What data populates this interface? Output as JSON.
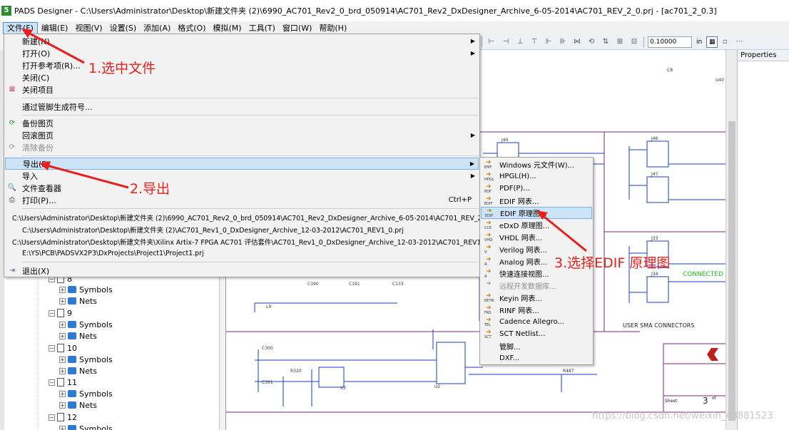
{
  "window": {
    "app_icon": "pads-app-icon",
    "title": "PADS Designer - C:\\Users\\Administrator\\Desktop\\新建文件夹 (2)\\6990_AC701_Rev2_0_brd_050914\\AC701_Rev2_DxDesigner_Archive_6-05-2014\\AC701_REV_2_0.prj - [ac701_2_0.3]"
  },
  "menubar": [
    "文件(F)",
    "编辑(E)",
    "视图(V)",
    "设置(S)",
    "添加(A)",
    "格式(O)",
    "模拟(M)",
    "工具(T)",
    "窗口(W)",
    "帮助(H)"
  ],
  "toolbar": {
    "zoom_value": "0.10000",
    "unit": "in"
  },
  "properties_title": "Properties",
  "tree": [
    {
      "type": "sheet",
      "label": "8"
    },
    {
      "type": "folder",
      "label": "Symbols"
    },
    {
      "type": "folder",
      "label": "Nets"
    },
    {
      "type": "sheet",
      "label": "9"
    },
    {
      "type": "folder",
      "label": "Symbols"
    },
    {
      "type": "folder",
      "label": "Nets"
    },
    {
      "type": "sheet",
      "label": "10"
    },
    {
      "type": "folder",
      "label": "Symbols"
    },
    {
      "type": "folder",
      "label": "Nets"
    },
    {
      "type": "sheet",
      "label": "11"
    },
    {
      "type": "folder",
      "label": "Symbols"
    },
    {
      "type": "folder",
      "label": "Nets"
    },
    {
      "type": "sheet",
      "label": "12"
    },
    {
      "type": "folder",
      "label": "Symbols"
    }
  ],
  "file_menu": [
    {
      "kind": "item",
      "label": "新建(N)",
      "icon": "",
      "submenu": true
    },
    {
      "kind": "item",
      "label": "打开(O)",
      "icon": "",
      "submenu": true
    },
    {
      "kind": "item",
      "label": "打开参考项(R)...",
      "icon": ""
    },
    {
      "kind": "item",
      "label": "关闭(C)",
      "icon": ""
    },
    {
      "kind": "item",
      "label": "关闭项目",
      "icon": "close-project-icon"
    },
    {
      "kind": "sep"
    },
    {
      "kind": "item",
      "label": "通过管脚生成符号..."
    },
    {
      "kind": "sep"
    },
    {
      "kind": "item",
      "label": "备份图页",
      "icon": "backup-icon"
    },
    {
      "kind": "item",
      "label": "回滚图页",
      "submenu": true
    },
    {
      "kind": "item",
      "label": "清除备份",
      "icon": "clear-backup-icon",
      "disabled": true
    },
    {
      "kind": "sep"
    },
    {
      "kind": "item",
      "label": "导出(E)",
      "submenu": true,
      "highlight": true
    },
    {
      "kind": "item",
      "label": "导入",
      "submenu": true
    },
    {
      "kind": "item",
      "label": "文件查看器",
      "icon": "file-viewer-icon"
    },
    {
      "kind": "item",
      "label": "打印(P)...",
      "icon": "print-icon",
      "shortcut": "Ctrl+P"
    },
    {
      "kind": "sep"
    },
    {
      "kind": "recent",
      "label": "C:\\Users\\Administrator\\Desktop\\新建文件夹 (2)\\6990_AC701_Rev2_0_brd_050914\\AC701_Rev2_DxDesigner_Archive_6-05-2014\\AC701_REV_2_0.prj"
    },
    {
      "kind": "recent",
      "label": "C:\\Users\\Administrator\\Desktop\\新建文件夹 (2)\\AC701_Rev1_0_DxDesigner_Archive_12-03-2012\\AC701_REV1_0.prj"
    },
    {
      "kind": "recent",
      "label": "C:\\Users\\Administrator\\Desktop\\新建文件夹\\Xilinx Artix-7 FPGA AC701 评估套件\\AC701_Rev1_0_DxDesigner_Archive_12-03-2012\\AC701_REV1_0.prj"
    },
    {
      "kind": "recent",
      "label": "E:\\YS\\PCB\\PADSVX2P3\\DxProjects\\Project1\\Project1.prj"
    },
    {
      "kind": "sep"
    },
    {
      "kind": "item",
      "label": "退出(X)",
      "icon": "exit-icon"
    }
  ],
  "export_menu": [
    {
      "label": "Windows 元文件(W)...",
      "tag": "EMF"
    },
    {
      "label": "HPGL(H)...",
      "tag": "HPGL"
    },
    {
      "label": "PDF(P)...",
      "tag": "PDF"
    },
    {
      "label": "EDIF 网表...",
      "tag": "EDIF"
    },
    {
      "label": "EDIF 原理图...",
      "tag": "EDIF",
      "highlight": true
    },
    {
      "label": "eDxD 原理图...",
      "tag": "CCE"
    },
    {
      "label": "VHDL 网表...",
      "tag": "VHD"
    },
    {
      "label": "Verilog 网表...",
      "tag": "V"
    },
    {
      "label": "Analog 网表...",
      "tag": "A"
    },
    {
      "label": "快速连接视图...",
      "tag": "A"
    },
    {
      "label": "远程开发数据库...",
      "tag": "",
      "disabled": true
    },
    {
      "label": "Keyin 网表...",
      "tag": "KEYN"
    },
    {
      "label": "RINF 网表...",
      "tag": "FRS"
    },
    {
      "label": "Cadence Allegro...",
      "tag": "TEL"
    },
    {
      "label": "SCT Netlist...",
      "tag": "SCT"
    },
    {
      "label": "管脚...",
      "tag": ""
    },
    {
      "label": "DXF...",
      "tag": ""
    }
  ],
  "schematic": {
    "connectors": [
      "J44",
      "J46",
      "J47",
      "J33",
      "J34"
    ],
    "caps": [
      "C190",
      "C191",
      "C133",
      "C300",
      "C301",
      "C8"
    ],
    "parts": [
      "L9",
      "U2",
      "X3",
      "R320",
      "R487",
      "U40"
    ],
    "sma_label": "USER SMA CONNECTORS",
    "connected_label": "CONNECTED",
    "sheet_label": "Sheet",
    "sheet_number": "3",
    "of_label": "of"
  },
  "annotations": {
    "step1": "1.选中文件",
    "step2": "2.导出",
    "step3": "3.选择EDIF 原理图",
    "watermark": "https://blog.csdn.net/weixin_43881523"
  },
  "colors": {
    "annotation": "#e8201c",
    "schematic_line": "#7a2a7a",
    "schematic_net": "#1a3dbb",
    "highlight": "#cde4f7"
  }
}
